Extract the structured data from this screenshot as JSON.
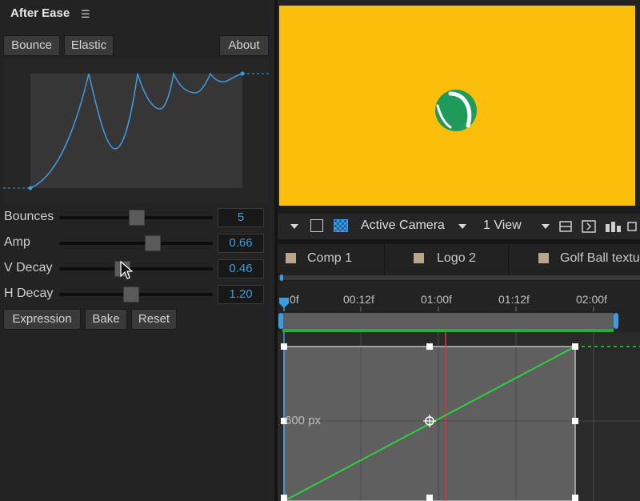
{
  "panel": {
    "title": "After Ease",
    "menu_icon": "hamburger-icon",
    "buttons": {
      "bounce": "Bounce",
      "elastic": "Elastic",
      "about": "About"
    },
    "params": [
      {
        "label": "Bounces",
        "value": "5",
        "slider": 0.5
      },
      {
        "label": "Amp",
        "value": "0.66",
        "slider": 0.62
      },
      {
        "label": "V Decay",
        "value": "0.46",
        "slider": 0.42
      },
      {
        "label": "H Decay",
        "value": "1.20",
        "slider": 0.47
      }
    ],
    "actions": {
      "expression": "Expression",
      "bake": "Bake",
      "reset": "Reset"
    }
  },
  "viewer": {
    "background": "#fbbe0a",
    "ball_color": "#1f9a5a",
    "camera": "Active Camera",
    "view": "1 View"
  },
  "tabs": [
    {
      "label": "Comp 1"
    },
    {
      "label": "Logo 2"
    },
    {
      "label": "Golf Ball textu"
    }
  ],
  "timeline": {
    "ticks": [
      "0f",
      "00:12f",
      "01:00f",
      "01:12f",
      "02:00f"
    ],
    "graph_value_label": "600 px",
    "curve_color": "#2fcf3f",
    "playhead_color": "#d23a3a"
  }
}
